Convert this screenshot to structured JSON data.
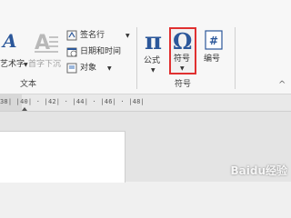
{
  "ribbon": {
    "text_group": {
      "wordart_label": "艺术字",
      "dropcap_label": "首字下沉",
      "signature_line_label": "签名行",
      "datetime_label": "日期和时间",
      "object_label": "对象",
      "group_label": "文本"
    },
    "symbols_group": {
      "equation_label": "公式",
      "symbol_label": "符号",
      "number_label": "编号",
      "group_label": "符号"
    },
    "collapse_glyph": "^"
  },
  "ruler": {
    "text": "38|  |40| · |42| · |44| · |46| · |48|"
  },
  "watermark": {
    "text": "Baidu经验"
  },
  "colors": {
    "highlight": "#e03030",
    "accent": "#2b579a"
  }
}
